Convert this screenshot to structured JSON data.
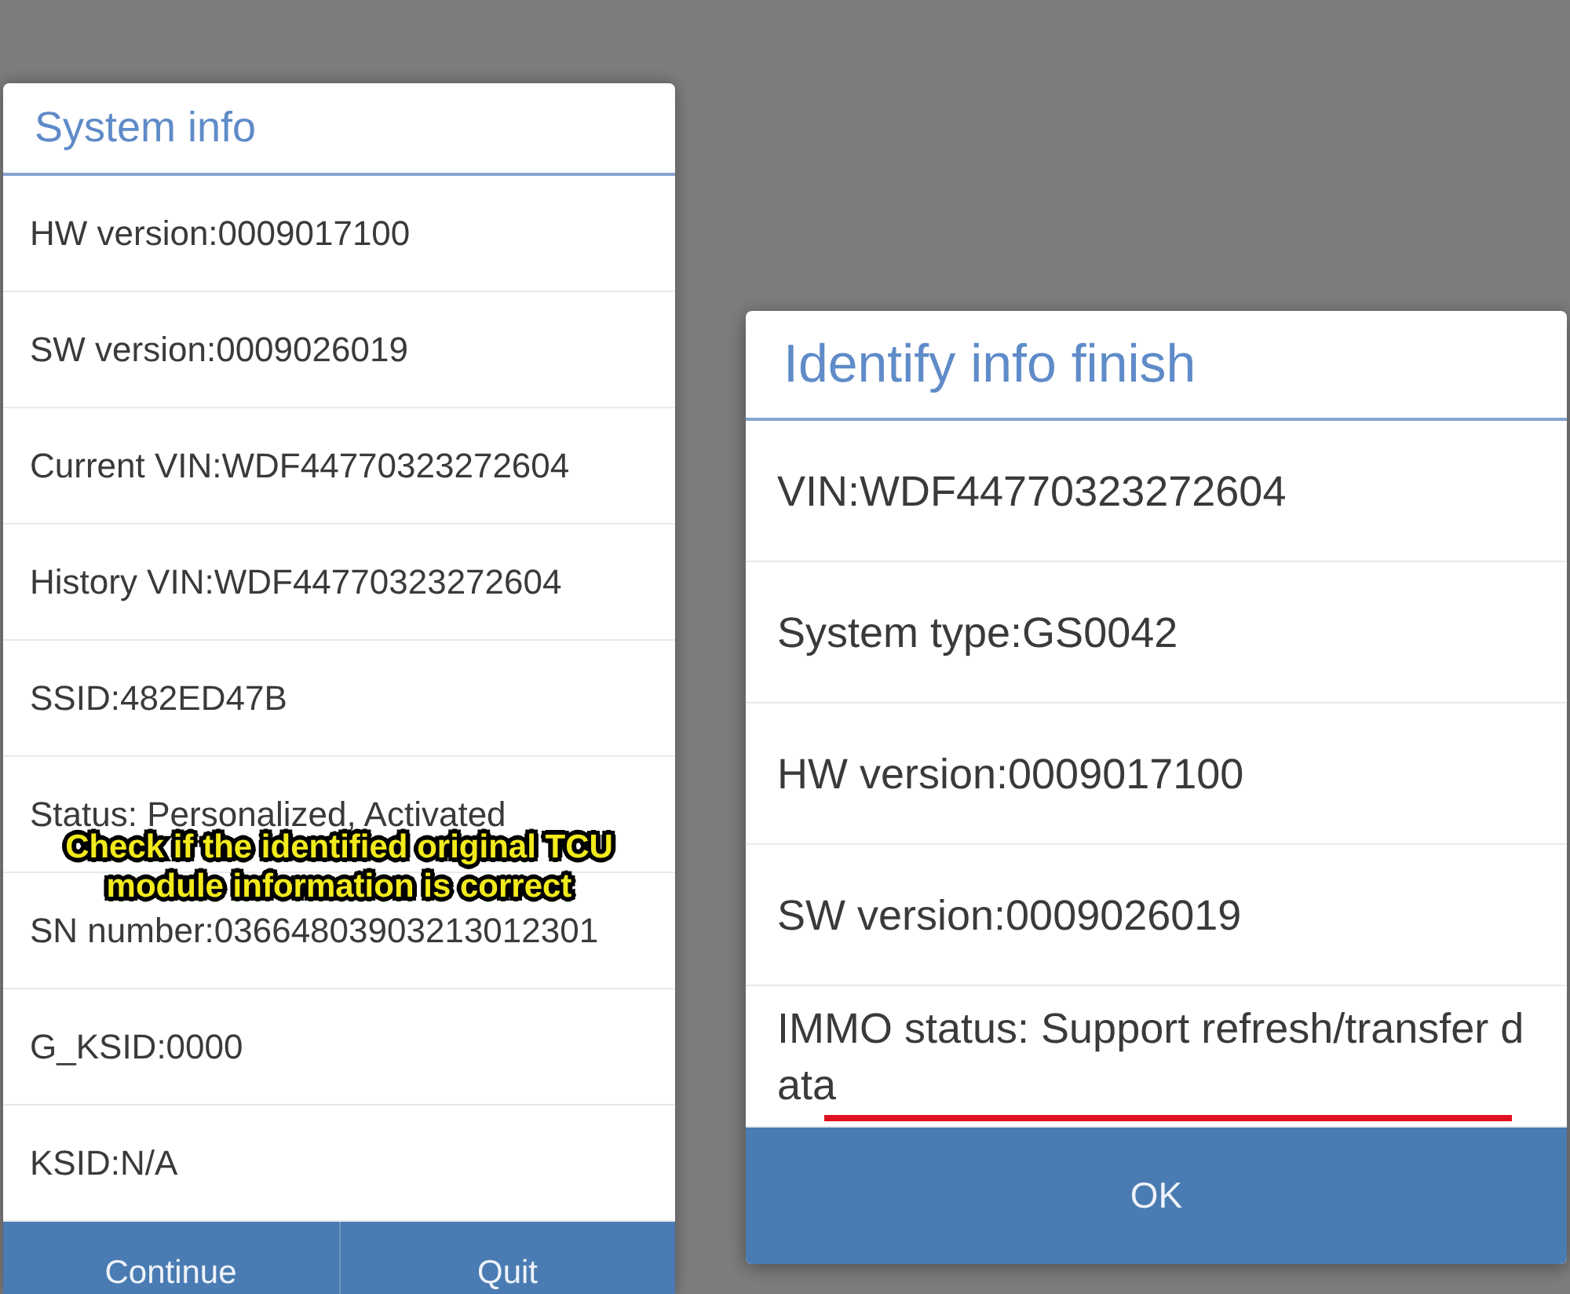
{
  "system_info": {
    "title": "System info",
    "rows": [
      "HW version:0009017100",
      "SW version:0009026019",
      "Current VIN:WDF44770323272604",
      "History VIN:WDF44770323272604",
      "SSID:482ED47B",
      "Status: Personalized, Activated",
      "SN number:03664803903213012301",
      "G_KSID:0000",
      "KSID:N/A"
    ],
    "buttons": [
      "Continue",
      "Quit"
    ]
  },
  "caption": "Check if the identified original TCU module information is correct",
  "identify_dialog": {
    "title": "Identify info finish",
    "rows": [
      "VIN:WDF44770323272604",
      "System type:GS0042",
      "HW version:0009017100",
      "SW version:0009026019",
      "IMMO status: Support refresh/transfer data"
    ],
    "buttons": [
      "OK"
    ]
  }
}
